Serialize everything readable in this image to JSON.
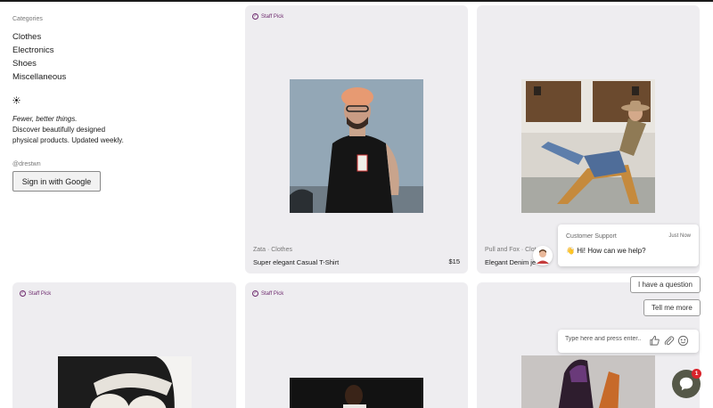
{
  "sidebar": {
    "heading": "Categories",
    "categories": [
      "Clothes",
      "Electronics",
      "Shoes",
      "Miscellaneous"
    ],
    "tagline_em": "Fewer, better things.",
    "tagline_1": "Discover beautifully designed",
    "tagline_2": "physical products. Updated weekly.",
    "handle": "@drestwn",
    "signin_label": "Sign in with Google"
  },
  "badge_label": "Staff Pick",
  "products": [
    {
      "brand_category": "Zata · Clothes",
      "name": "Super elegant Casual T-Shirt",
      "price": "$15",
      "staff_pick": true
    },
    {
      "brand_category": "Pull and Fox · Clot",
      "name": "Elegant Denim je",
      "staff_pick": false
    },
    {
      "staff_pick": true
    },
    {
      "staff_pick": true
    },
    {
      "staff_pick": false
    }
  ],
  "support": {
    "from": "Customer Support",
    "time": "Just Now",
    "emoji": "👋",
    "message": "Hi! How can we help?",
    "quick_replies": [
      "I have a question",
      "Tell me more"
    ],
    "input_placeholder": "Type here and press enter..",
    "unread_count": "1"
  },
  "colors": {
    "card_bg": "#eeedf0",
    "badge": "#6d2a6e",
    "launcher": "#555848",
    "notif": "#d9232b"
  }
}
